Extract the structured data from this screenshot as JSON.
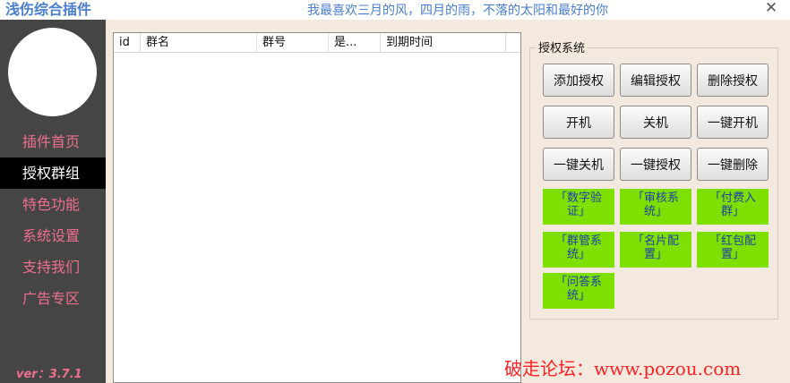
{
  "window": {
    "title": "浅伤综合插件",
    "slogan": "我最喜欢三月的风，四月的雨，不落的太阳和最好的你",
    "close_glyph": "✕"
  },
  "sidebar": {
    "items": [
      {
        "label": "插件首页"
      },
      {
        "label": "授权群组"
      },
      {
        "label": "特色功能"
      },
      {
        "label": "系统设置"
      },
      {
        "label": "支持我们"
      },
      {
        "label": "广告专区"
      }
    ],
    "active_index": 1,
    "version": "ver：3.7.1"
  },
  "table": {
    "columns": [
      "id",
      "群名",
      "群号",
      "是...",
      "到期时间"
    ],
    "rows": []
  },
  "auth": {
    "title": "授权系统",
    "buttons": [
      "添加授权",
      "编辑授权",
      "删除授权",
      "开机",
      "关机",
      "一键开机",
      "一键关机",
      "一键授权",
      "一键删除"
    ],
    "features": [
      "「数字验证」",
      "「审核系统」",
      "「付费入群」",
      "「群管系统」",
      "「名片配置」",
      "「红包配置」",
      "「问答系统」"
    ]
  },
  "watermark": "破走论坛：www.pozou.com",
  "colors": {
    "accent_text": "#4a7fd0",
    "sidebar_bg": "#454545",
    "nav_text": "#ee6f8c",
    "feature_bg": "#7ee000",
    "feature_text": "#1d3fae"
  }
}
